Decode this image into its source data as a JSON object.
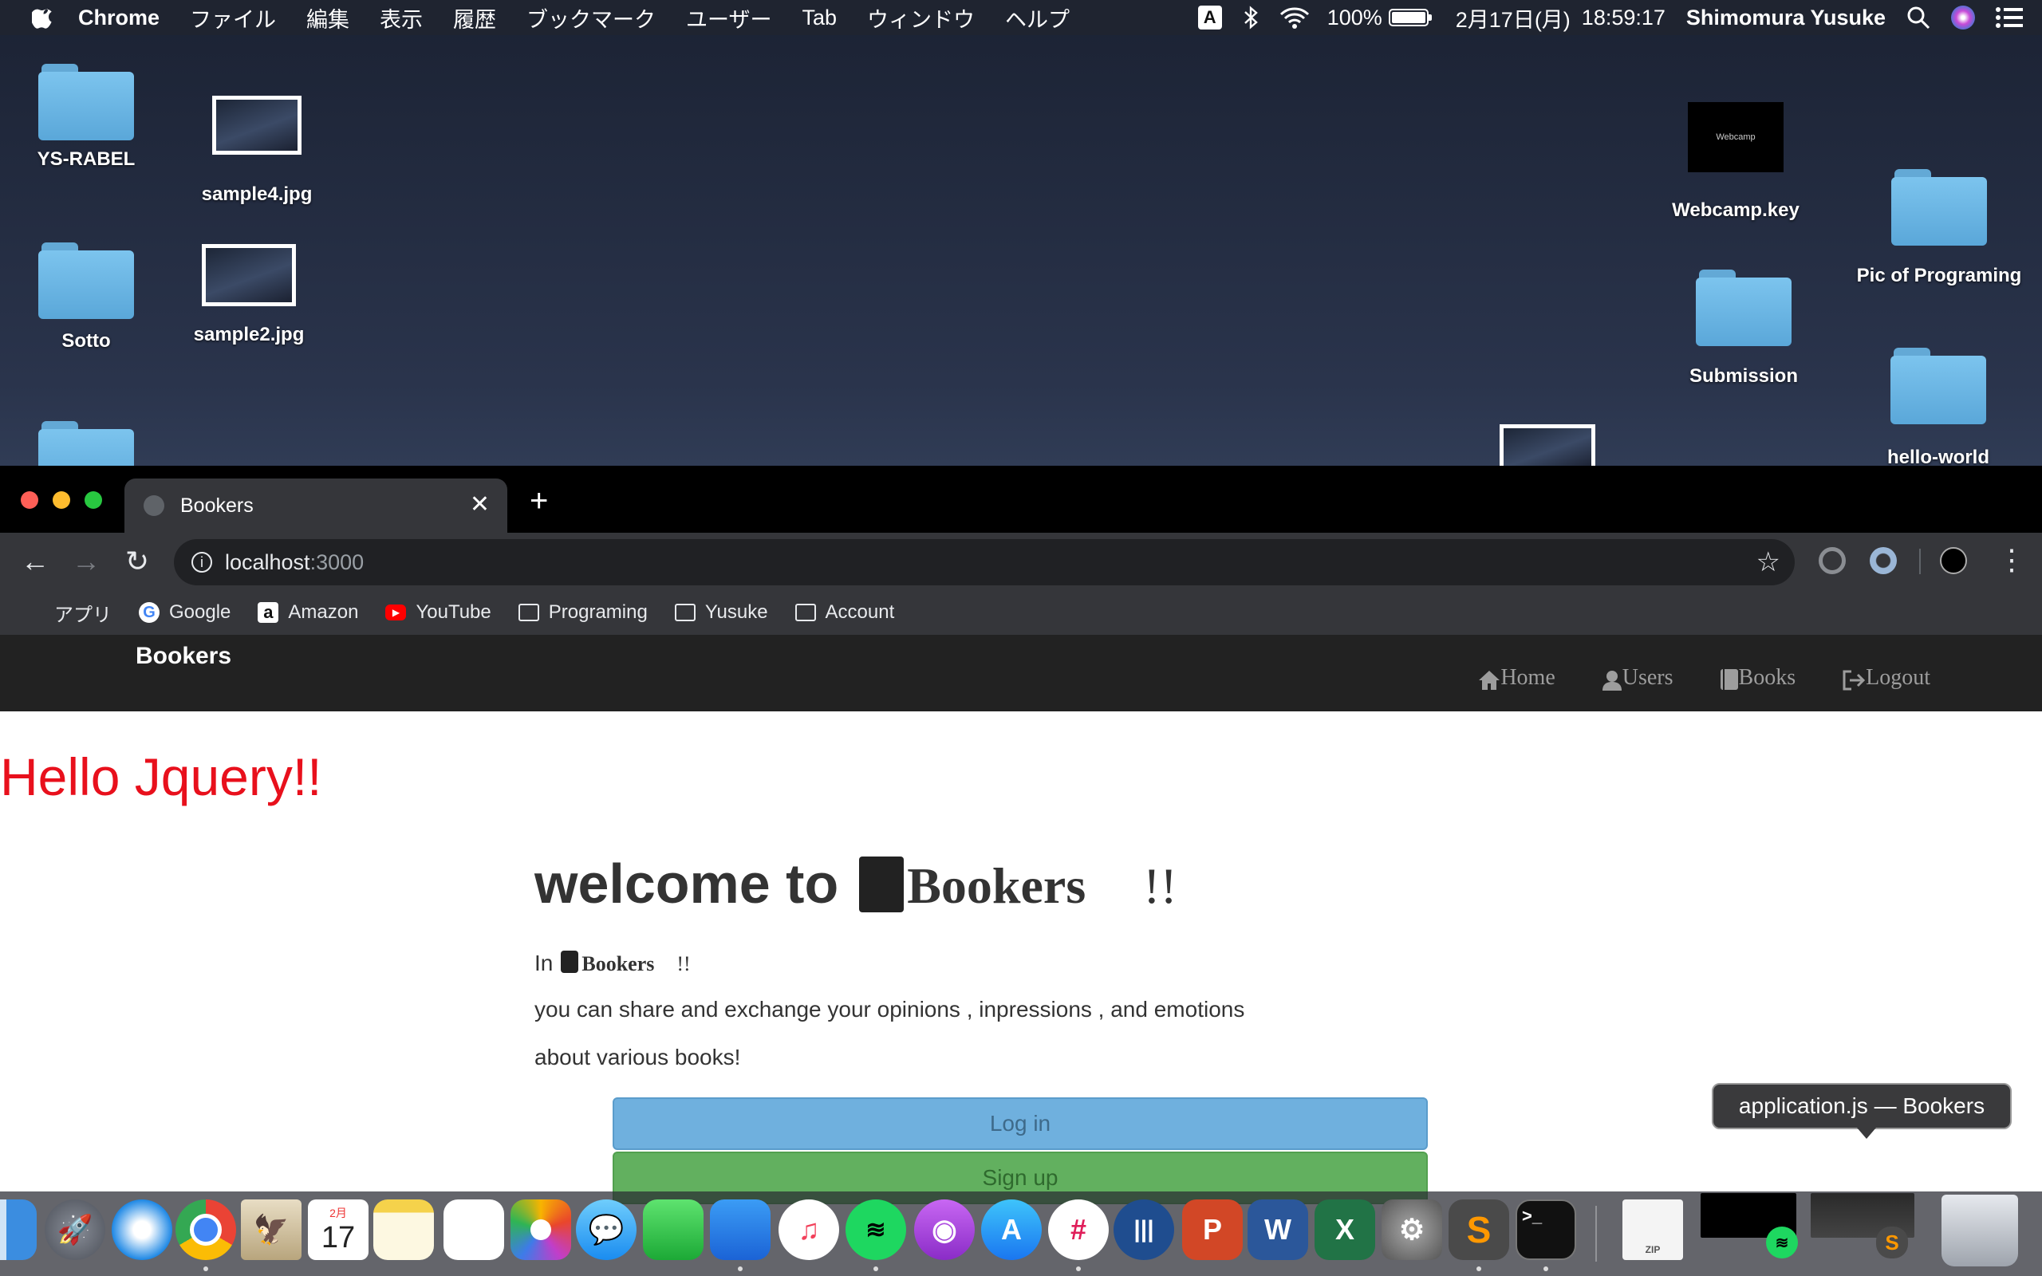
{
  "menubar": {
    "app": "Chrome",
    "menus": [
      "ファイル",
      "編集",
      "表示",
      "履歴",
      "ブックマーク",
      "ユーザー",
      "Tab",
      "ウィンドウ",
      "ヘルプ"
    ],
    "ime": "A",
    "battery": "100%",
    "battery_level": 1.0,
    "date": "2月17日(月)",
    "time": "18:59:17",
    "user": "Shimomura Yusuke"
  },
  "desktop": {
    "items": [
      "YS-RABEL",
      "sample4.jpg",
      "Sotto",
      "sample2.jpg",
      "Webcamp.key",
      "Pic of Programing",
      "Submission",
      "hello-world"
    ],
    "keynote_thumb_text": "Webcamp"
  },
  "browser": {
    "tab_title": "Bookers",
    "url_host": "localhost",
    "url_port": ":3000",
    "bookmarks": [
      "アプリ",
      "Google",
      "Amazon",
      "YouTube",
      "Programing",
      "Yusuke",
      "Account"
    ]
  },
  "site": {
    "brand": "Bookers",
    "nav": [
      "Home",
      "Users",
      "Books",
      "Logout"
    ],
    "hello": "Hello Jquery!!",
    "welcome_prefix": "welcome to",
    "brand_word": "Bookers",
    "exclaim": "!!",
    "in_prefix": "In",
    "para1": "you can share and exchange your opinions , inpressions , and emotions",
    "para2": "about various books!",
    "login": "Log in",
    "signup": "Sign up"
  },
  "tooltip": "application.js — Bookers",
  "dock": {
    "calendar_month": "2月",
    "calendar_day": "17",
    "zip_label": "ZIP"
  }
}
